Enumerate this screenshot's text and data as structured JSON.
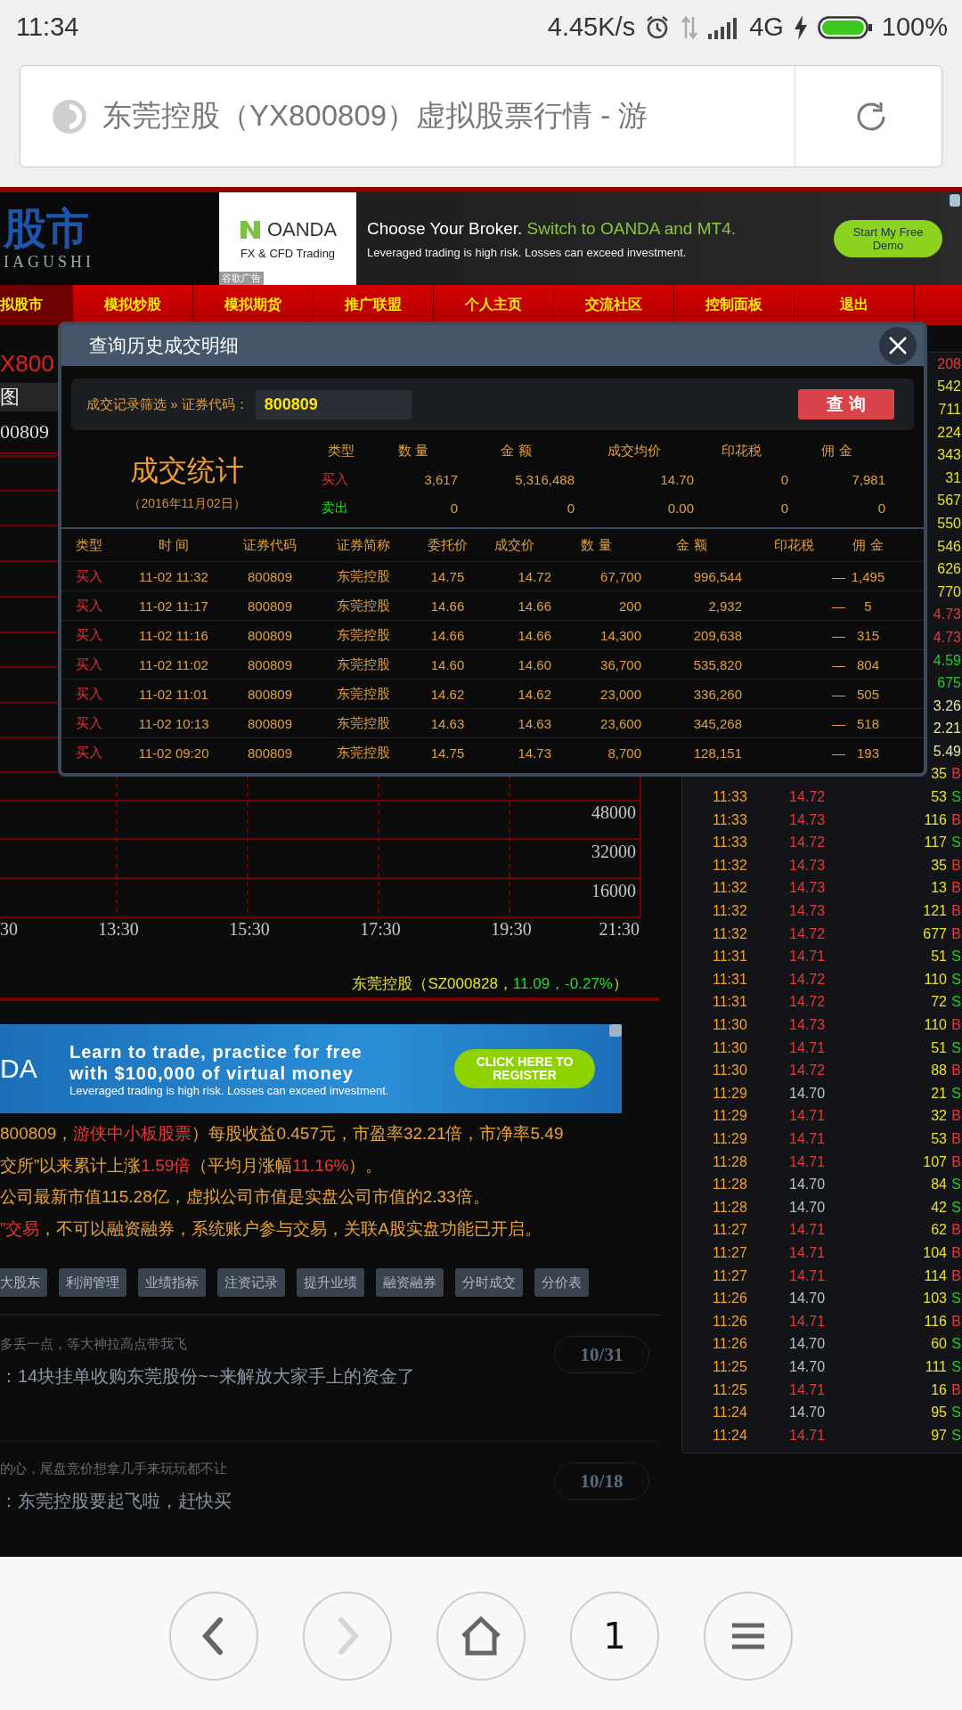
{
  "status_bar": {
    "time": "11:34",
    "net_speed": "4.45K/s",
    "network": "4G",
    "battery": "100%"
  },
  "address_bar": {
    "title": "东莞控股（YX800809）虚拟股票行情 - 游"
  },
  "site_header": {
    "logo_text": "股市",
    "logo_subtext": "IAGUSHI"
  },
  "top_ad": {
    "brand": "OANDA",
    "brand_tagline": "FX & CFD Trading",
    "ad_label": "谷歌广告",
    "headline": "Choose Your Broker.",
    "headline_highlight": "Switch to OANDA and MT4.",
    "disclaimer": "Leveraged trading is high risk. Losses can exceed investment.",
    "cta": "Start My Free Demo"
  },
  "nav": [
    {
      "label": "拟股市",
      "selected": true
    },
    {
      "label": "模拟炒股",
      "selected": false
    },
    {
      "label": "模拟期货",
      "selected": false
    },
    {
      "label": "推广联盟",
      "selected": false
    },
    {
      "label": "个人主页",
      "selected": false
    },
    {
      "label": "交流社区",
      "selected": false
    },
    {
      "label": "控制面板",
      "selected": false
    },
    {
      "label": "退出",
      "selected": false
    }
  ],
  "stock_header": {
    "title": "X800",
    "tab": "图",
    "code": "00809"
  },
  "chart": {
    "y_labels": [
      "48000",
      "32000",
      "16000"
    ],
    "x_labels": [
      "30",
      "13:30",
      "15:30",
      "17:30",
      "19:30",
      "21:30"
    ]
  },
  "related_stock": {
    "text_before": "东莞控股（SZ000828，",
    "quote": "11.09，-0.27%",
    "text_after": "）"
  },
  "bottom_ad": {
    "logo": "DA",
    "line1": "Learn to trade, practice for free",
    "line2": "with $100,000 of virtual money",
    "disclaimer": "Leveraged trading is high risk. Losses can exceed investment.",
    "cta": "CLICK HERE TO REGISTER"
  },
  "description_lines": [
    {
      "segments": [
        {
          "text": "800809，",
          "highlight": false
        },
        {
          "text": "游侠中小板股票",
          "highlight": true
        },
        {
          "text": "）每股收益0.457元，市盈率32.21倍，市净率5.49",
          "highlight": false
        }
      ]
    },
    {
      "segments": [
        {
          "text": "交所”以来累计上涨",
          "highlight": false
        },
        {
          "text": "1.59倍",
          "highlight": true
        },
        {
          "text": "（平均月涨幅",
          "highlight": false
        },
        {
          "text": "11.16%",
          "highlight": true
        },
        {
          "text": "）。",
          "highlight": false
        }
      ]
    },
    {
      "segments": [
        {
          "text": "公司最新市值115.28亿，虚拟公司市值是实盘公司市值的2.33倍。",
          "highlight": false
        }
      ]
    },
    {
      "segments": [
        {
          "text": "”交易",
          "highlight": true
        },
        {
          "text": "，不可以融资融券，系统账户参与交易，关联A股实盘功能已开启。",
          "highlight": false
        }
      ]
    }
  ],
  "function_buttons": [
    "大股东",
    "利润管理",
    "业绩指标",
    "注资记录",
    "提升业绩",
    "融资融券",
    "分时成交",
    "分价表"
  ],
  "comments": [
    {
      "preview": "多丢一点，等大神拉高点带我飞",
      "reply": "：14块挂单收购东莞股份~~来解放大家手上的资金了",
      "date": "10/31"
    },
    {
      "preview": "的心，尾盘竞价想拿几手来玩玩都不让",
      "reply": "：东莞控股要起飞啦，赶快买",
      "date": "10/18"
    }
  ],
  "ticker": [
    {
      "kind": "fragment",
      "text": "208",
      "color": "#e53935"
    },
    {
      "kind": "fragment",
      "text": "542",
      "color": "#e8e020"
    },
    {
      "kind": "fragment",
      "text": "711",
      "color": "#e8e020"
    },
    {
      "kind": "fragment",
      "text": "224",
      "color": "#e8e020"
    },
    {
      "kind": "fragment",
      "text": "343",
      "color": "#e8e020"
    },
    {
      "kind": "fragment",
      "text": "31",
      "color": "#e8e020"
    },
    {
      "kind": "fragment",
      "text": "567",
      "color": "#e8e020"
    },
    {
      "kind": "fragment",
      "text": "550",
      "color": "#e8e020"
    },
    {
      "kind": "fragment",
      "text": "546",
      "color": "#e8e020"
    },
    {
      "kind": "fragment",
      "text": "626",
      "color": "#e8e020"
    },
    {
      "kind": "fragment",
      "text": "770",
      "color": "#e8e020"
    },
    {
      "kind": "fragment",
      "text": "4.73",
      "color": "#e53935"
    },
    {
      "kind": "fragment",
      "text": "4.73",
      "color": "#e53935"
    },
    {
      "kind": "fragment",
      "text": "4.59",
      "color": "#22cc22"
    },
    {
      "kind": "fragment",
      "text": "675",
      "color": "#22cc22"
    },
    {
      "kind": "fragment",
      "text": "3.26",
      "color": "#e6e6a0"
    },
    {
      "kind": "fragment",
      "text": "2.21",
      "color": "#e6e6a0"
    },
    {
      "kind": "fragment",
      "text": "5.49",
      "color": "#e6e6a0"
    },
    {
      "kind": "trade",
      "volume": "35",
      "side": {
        "text": "B",
        "color": "#e53935"
      }
    },
    {
      "kind": "trade",
      "time": "11:33",
      "price": {
        "text": "14.72",
        "color": "#e53935"
      },
      "volume": "53",
      "side": {
        "text": "S",
        "color": "#22cc22"
      }
    },
    {
      "kind": "trade",
      "time": "11:33",
      "price": {
        "text": "14.73",
        "color": "#e53935"
      },
      "volume": "116",
      "side": {
        "text": "B",
        "color": "#e53935"
      }
    },
    {
      "kind": "trade",
      "time": "11:33",
      "price": {
        "text": "14.72",
        "color": "#e53935"
      },
      "volume": "117",
      "side": {
        "text": "S",
        "color": "#22cc22"
      }
    },
    {
      "kind": "trade",
      "time": "11:32",
      "price": {
        "text": "14.73",
        "color": "#e53935"
      },
      "volume": "35",
      "side": {
        "text": "B",
        "color": "#e53935"
      }
    },
    {
      "kind": "trade",
      "time": "11:32",
      "price": {
        "text": "14.73",
        "color": "#e53935"
      },
      "volume": "13",
      "side": {
        "text": "B",
        "color": "#e53935"
      }
    },
    {
      "kind": "trade",
      "time": "11:32",
      "price": {
        "text": "14.73",
        "color": "#e53935"
      },
      "volume": "121",
      "side": {
        "text": "B",
        "color": "#e53935"
      }
    },
    {
      "kind": "trade",
      "time": "11:32",
      "price": {
        "text": "14.72",
        "color": "#e53935"
      },
      "volume": "677",
      "side": {
        "text": "B",
        "color": "#e53935"
      }
    },
    {
      "kind": "trade",
      "time": "11:31",
      "price": {
        "text": "14.71",
        "color": "#e53935"
      },
      "volume": "51",
      "side": {
        "text": "S",
        "color": "#22cc22"
      }
    },
    {
      "kind": "trade",
      "time": "11:31",
      "price": {
        "text": "14.72",
        "color": "#e53935"
      },
      "volume": "110",
      "side": {
        "text": "S",
        "color": "#22cc22"
      }
    },
    {
      "kind": "trade",
      "time": "11:31",
      "price": {
        "text": "14.72",
        "color": "#e53935"
      },
      "volume": "72",
      "side": {
        "text": "S",
        "color": "#22cc22"
      }
    },
    {
      "kind": "trade",
      "time": "11:30",
      "price": {
        "text": "14.73",
        "color": "#e53935"
      },
      "volume": "110",
      "side": {
        "text": "B",
        "color": "#e53935"
      }
    },
    {
      "kind": "trade",
      "time": "11:30",
      "price": {
        "text": "14.71",
        "color": "#e53935"
      },
      "volume": "51",
      "side": {
        "text": "S",
        "color": "#22cc22"
      }
    },
    {
      "kind": "trade",
      "time": "11:30",
      "price": {
        "text": "14.72",
        "color": "#e53935"
      },
      "volume": "88",
      "side": {
        "text": "B",
        "color": "#e53935"
      }
    },
    {
      "kind": "trade",
      "time": "11:29",
      "price": {
        "text": "14.70",
        "color": "#b8c0c8"
      },
      "volume": "21",
      "side": {
        "text": "S",
        "color": "#22cc22"
      }
    },
    {
      "kind": "trade",
      "time": "11:29",
      "price": {
        "text": "14.71",
        "color": "#e53935"
      },
      "volume": "32",
      "side": {
        "text": "B",
        "color": "#e53935"
      }
    },
    {
      "kind": "trade",
      "time": "11:29",
      "price": {
        "text": "14.71",
        "color": "#e53935"
      },
      "volume": "53",
      "side": {
        "text": "B",
        "color": "#e53935"
      }
    },
    {
      "kind": "trade",
      "time": "11:28",
      "price": {
        "text": "14.71",
        "color": "#e53935"
      },
      "volume": "107",
      "side": {
        "text": "B",
        "color": "#e53935"
      }
    },
    {
      "kind": "trade",
      "time": "11:28",
      "price": {
        "text": "14.70",
        "color": "#b8c0c8"
      },
      "volume": "84",
      "side": {
        "text": "S",
        "color": "#22cc22"
      }
    },
    {
      "kind": "trade",
      "time": "11:28",
      "price": {
        "text": "14.70",
        "color": "#b8c0c8"
      },
      "volume": "42",
      "side": {
        "text": "S",
        "color": "#22cc22"
      }
    },
    {
      "kind": "trade",
      "time": "11:27",
      "price": {
        "text": "14.71",
        "color": "#e53935"
      },
      "volume": "62",
      "side": {
        "text": "B",
        "color": "#e53935"
      }
    },
    {
      "kind": "trade",
      "time": "11:27",
      "price": {
        "text": "14.71",
        "color": "#e53935"
      },
      "volume": "104",
      "side": {
        "text": "B",
        "color": "#e53935"
      }
    },
    {
      "kind": "trade",
      "time": "11:27",
      "price": {
        "text": "14.71",
        "color": "#e53935"
      },
      "volume": "114",
      "side": {
        "text": "B",
        "color": "#e53935"
      }
    },
    {
      "kind": "trade",
      "time": "11:26",
      "price": {
        "text": "14.70",
        "color": "#b8c0c8"
      },
      "volume": "103",
      "side": {
        "text": "S",
        "color": "#22cc22"
      }
    },
    {
      "kind": "trade",
      "time": "11:26",
      "price": {
        "text": "14.71",
        "color": "#e53935"
      },
      "volume": "116",
      "side": {
        "text": "B",
        "color": "#e53935"
      }
    },
    {
      "kind": "trade",
      "time": "11:26",
      "price": {
        "text": "14.70",
        "color": "#b8c0c8"
      },
      "volume": "60",
      "side": {
        "text": "S",
        "color": "#22cc22"
      }
    },
    {
      "kind": "trade",
      "time": "11:25",
      "price": {
        "text": "14.70",
        "color": "#b8c0c8"
      },
      "volume": "111",
      "side": {
        "text": "S",
        "color": "#22cc22"
      }
    },
    {
      "kind": "trade",
      "time": "11:25",
      "price": {
        "text": "14.71",
        "color": "#e53935"
      },
      "volume": "16",
      "side": {
        "text": "B",
        "color": "#e53935"
      }
    },
    {
      "kind": "trade",
      "time": "11:24",
      "price": {
        "text": "14.70",
        "color": "#b8c0c8"
      },
      "volume": "95",
      "side": {
        "text": "S",
        "color": "#22cc22"
      }
    },
    {
      "kind": "trade",
      "time": "11:24",
      "price": {
        "text": "14.71",
        "color": "#e53935"
      },
      "volume": "97",
      "side": {
        "text": "S",
        "color": "#22cc22"
      }
    }
  ],
  "popup": {
    "title": "查询历史成交明细",
    "filter_label": "成交记录筛选 » 证券代码：",
    "code_value": "800809",
    "query_button": "查 询",
    "summary_title": "成交统计",
    "summary_date": "（2016年11月02日）",
    "summary_columns": [
      "类型",
      "数 量",
      "金 额",
      "成交均价",
      "印花税",
      "佣 金"
    ],
    "summary_rows": [
      {
        "kind": "buy",
        "type": "买入",
        "quantity": "3,617",
        "amount": "5,316,488",
        "avg_price": "14.70",
        "stamp_tax": "0",
        "commission": "7,981"
      },
      {
        "kind": "sell",
        "type": "卖出",
        "quantity": "0",
        "amount": "0",
        "avg_price": "0.00",
        "stamp_tax": "0",
        "commission": "0"
      }
    ],
    "columns": [
      "类型",
      "时 间",
      "证券代码",
      "证券简称",
      "委托价",
      "成交价",
      "数 量",
      "金 额",
      "印花税",
      "佣 金"
    ],
    "rows": [
      {
        "kind": "buy",
        "type": "买入",
        "time": "11-02 11:32",
        "code": "800809",
        "name": "东莞控股",
        "order_price": "14.75",
        "deal_price": "14.72",
        "quantity": "67,700",
        "amount": "996,544",
        "stamp_tax": "—",
        "commission": "1,495"
      },
      {
        "kind": "buy",
        "type": "买入",
        "time": "11-02 11:17",
        "code": "800809",
        "name": "东莞控股",
        "order_price": "14.66",
        "deal_price": "14.66",
        "quantity": "200",
        "amount": "2,932",
        "stamp_tax": "—",
        "commission": "5"
      },
      {
        "kind": "buy",
        "type": "买入",
        "time": "11-02 11:16",
        "code": "800809",
        "name": "东莞控股",
        "order_price": "14.66",
        "deal_price": "14.66",
        "quantity": "14,300",
        "amount": "209,638",
        "stamp_tax": "—",
        "commission": "315"
      },
      {
        "kind": "buy",
        "type": "买入",
        "time": "11-02 11:02",
        "code": "800809",
        "name": "东莞控股",
        "order_price": "14.60",
        "deal_price": "14.60",
        "quantity": "36,700",
        "amount": "535,820",
        "stamp_tax": "—",
        "commission": "804"
      },
      {
        "kind": "buy",
        "type": "买入",
        "time": "11-02 11:01",
        "code": "800809",
        "name": "东莞控股",
        "order_price": "14.62",
        "deal_price": "14.62",
        "quantity": "23,000",
        "amount": "336,260",
        "stamp_tax": "—",
        "commission": "505"
      },
      {
        "kind": "buy",
        "type": "买入",
        "time": "11-02 10:13",
        "code": "800809",
        "name": "东莞控股",
        "order_price": "14.63",
        "deal_price": "14.63",
        "quantity": "23,600",
        "amount": "345,268",
        "stamp_tax": "—",
        "commission": "518"
      },
      {
        "kind": "buy",
        "type": "买入",
        "time": "11-02 09:20",
        "code": "800809",
        "name": "东莞控股",
        "order_price": "14.75",
        "deal_price": "14.73",
        "quantity": "8,700",
        "amount": "128,151",
        "stamp_tax": "—",
        "commission": "193"
      }
    ]
  },
  "toolbar": [
    {
      "kind": "back",
      "disabled": false
    },
    {
      "kind": "forward",
      "disabled": true
    },
    {
      "kind": "home",
      "disabled": false
    },
    {
      "kind": "tabs",
      "label": "1",
      "disabled": false
    },
    {
      "kind": "menu",
      "disabled": false
    }
  ]
}
